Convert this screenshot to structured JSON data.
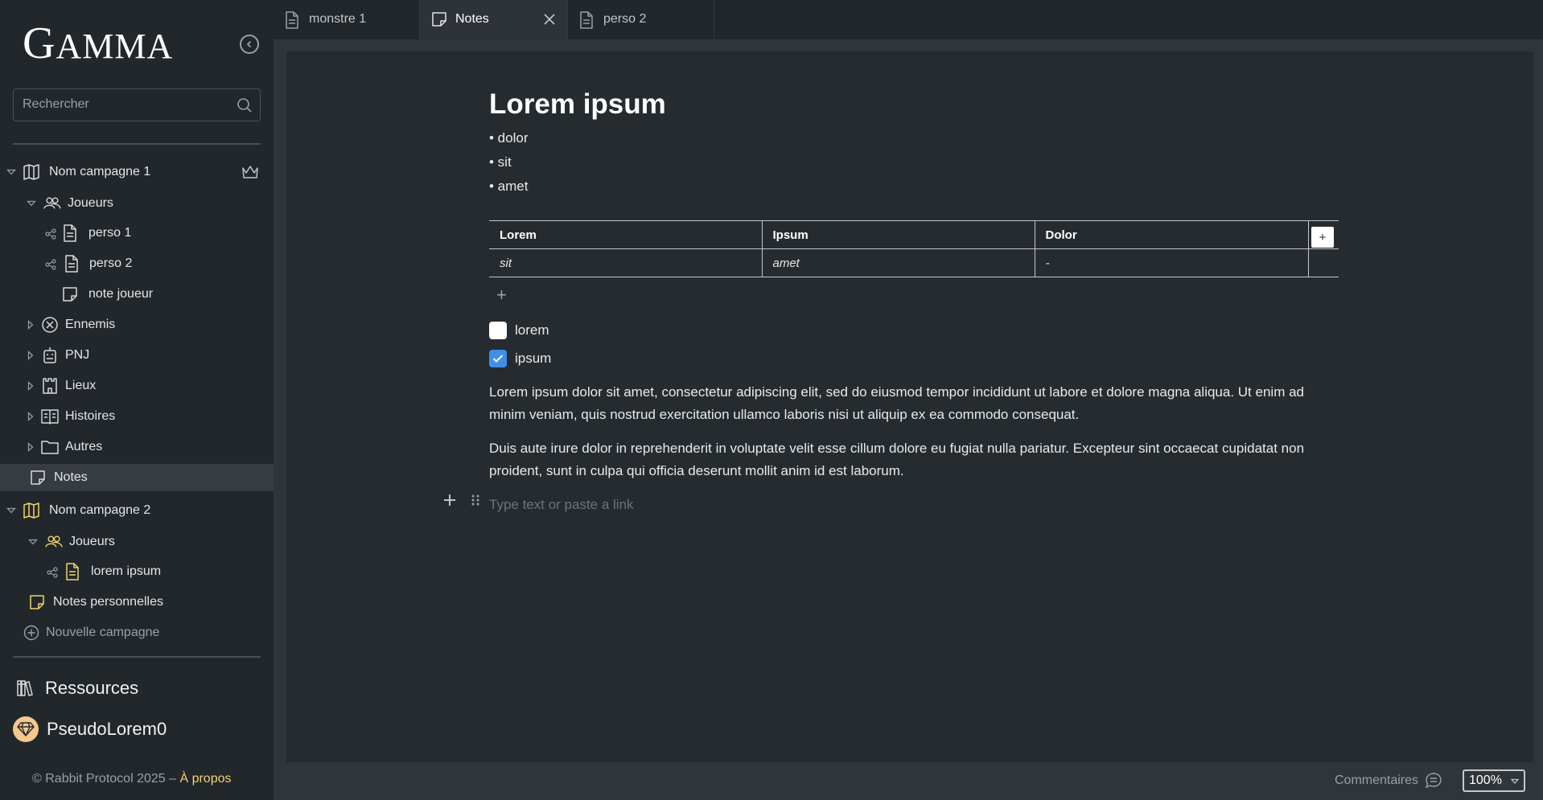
{
  "app": {
    "logo": "GAMMA",
    "logo_first": "G",
    "logo_rest": "AMMA"
  },
  "search": {
    "placeholder": "Rechercher"
  },
  "tree": {
    "campaign1": {
      "label": "Nom campagne 1",
      "players_label": "Joueurs",
      "players": [
        "perso 1",
        "perso 2"
      ],
      "player_note": "note joueur",
      "groups": [
        "Ennemis",
        "PNJ",
        "Lieux",
        "Histoires",
        "Autres"
      ],
      "notes": "Notes"
    },
    "campaign2": {
      "label": "Nom campagne 2",
      "players_label": "Joueurs",
      "players": [
        "lorem ipsum"
      ],
      "personal_notes": "Notes personnelles"
    },
    "new_campaign": "Nouvelle campagne"
  },
  "resources": {
    "label": "Ressources"
  },
  "user": {
    "name": "PseudoLorem0"
  },
  "footer": {
    "text": "© Rabbit Protocol 2025 – ",
    "link": "À propos"
  },
  "tabs": [
    {
      "label": "monstre 1",
      "active": false
    },
    {
      "label": "Notes",
      "active": true
    },
    {
      "label": "perso 2",
      "active": false
    }
  ],
  "document": {
    "title": "Lorem ipsum",
    "bullets": [
      "• dolor",
      "• sit",
      "• amet"
    ],
    "table": {
      "headers": [
        "Lorem",
        "Ipsum",
        "Dolor"
      ],
      "rows": [
        [
          "sit",
          "amet",
          "-"
        ]
      ],
      "add_column": "+",
      "add_row": "+"
    },
    "checkboxes": [
      {
        "label": "lorem",
        "checked": false
      },
      {
        "label": "ipsum",
        "checked": true
      }
    ],
    "paragraphs": [
      "Lorem ipsum dolor sit amet, consectetur adipiscing elit, sed do eiusmod tempor incididunt ut labore et dolore magna aliqua. Ut enim ad minim veniam, quis nostrud exercitation ullamco laboris nisi ut aliquip ex ea commodo consequat.",
      "Duis aute irure dolor in reprehenderit in voluptate velit esse cillum dolore eu fugiat nulla pariatur. Excepteur sint occaecat cupidatat non proident, sunt in culpa qui officia deserunt mollit anim id est laborum."
    ],
    "input_placeholder": "Type text or paste a link"
  },
  "status": {
    "comments_label": "Commentaires",
    "zoom": "100%"
  },
  "colors": {
    "accent": "#3f8fe8",
    "link": "#f2d36b",
    "sidebar_bg": "#22272b",
    "editor_bg": "#262b2f"
  }
}
